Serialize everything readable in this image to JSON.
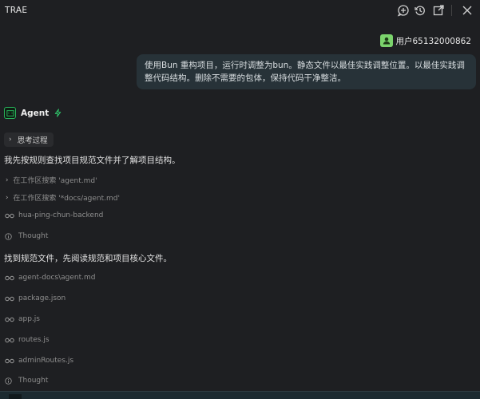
{
  "app": {
    "title": "TRAE"
  },
  "titlebar_icons": [
    "new-chat-icon",
    "history-icon",
    "popout-icon",
    "close-icon"
  ],
  "user": {
    "name": "用户65132000862"
  },
  "user_message": "使用Bun 重构项目，运行时调整为bun。静态文件以最佳实践调整位置。以最佳实践调整代码结构。删除不需要的包体，保持代码干净整洁。",
  "agent": {
    "name": "Agent"
  },
  "thinking": {
    "label": "思考过程"
  },
  "messages": {
    "m1": "我先按规则查找项目规范文件并了解项目结构。",
    "m2": "找到规范文件，先阅读规范和项目核心文件。"
  },
  "steps": [
    {
      "icon": "chevron-right-icon",
      "text": "在工作区搜索 'agent.md'"
    },
    {
      "icon": "chevron-right-icon",
      "text": "在工作区搜索 '*docs/agent.md'"
    },
    {
      "icon": "glasses-icon",
      "text": "hua-ping-chun-backend"
    },
    {
      "icon": "info-icon",
      "text": "Thought"
    },
    {
      "icon": "glasses-icon",
      "text": "agent-docs\\agent.md"
    },
    {
      "icon": "glasses-icon",
      "text": "package.json"
    },
    {
      "icon": "glasses-icon",
      "text": "app.js"
    },
    {
      "icon": "glasses-icon",
      "text": "routes.js"
    },
    {
      "icon": "glasses-icon",
      "text": "adminRoutes.js"
    },
    {
      "icon": "info-icon",
      "text": "Thought"
    }
  ],
  "colors": {
    "background": "#1e1f22",
    "bubble": "#273238",
    "agent_accent": "#28b35a",
    "avatar": "#7bd36c"
  }
}
